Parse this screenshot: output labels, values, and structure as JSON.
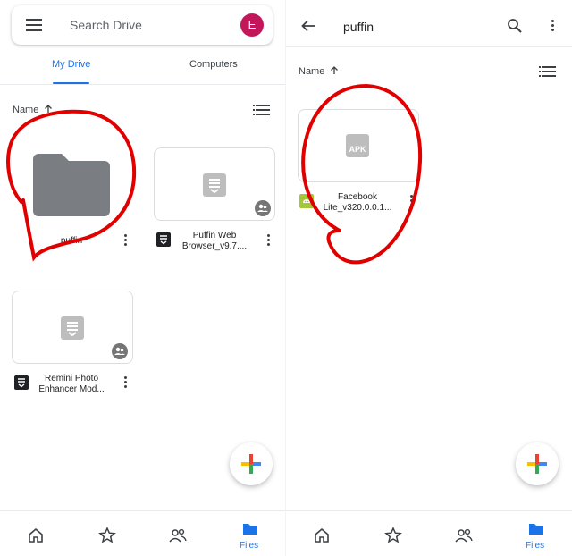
{
  "left": {
    "search": {
      "placeholder": "Search Drive",
      "avatar_letter": "E"
    },
    "tabs": [
      {
        "label": "My Drive",
        "active": true
      },
      {
        "label": "Computers",
        "active": false
      }
    ],
    "sort": {
      "label": "Name",
      "direction": "ascending"
    },
    "items": [
      {
        "type": "folder",
        "name": "puffin"
      },
      {
        "type": "document",
        "name_line1": "Puffin Web",
        "name_line2": "Browser_v9.7....",
        "shared": true
      },
      {
        "type": "document",
        "name_line1": "Remini Photo",
        "name_line2": "Enhancer Mod...",
        "shared": true
      }
    ],
    "nav": {
      "files_label": "Files",
      "items": [
        "home-icon",
        "star-icon",
        "shared-people-icon",
        "files-folder-icon"
      ],
      "active": "files"
    }
  },
  "right": {
    "title": "puffin",
    "sort": {
      "label": "Name",
      "direction": "ascending"
    },
    "items": [
      {
        "type": "apk",
        "thumb_text": "APK",
        "name_line1": "Facebook",
        "name_line2": "Lite_v320.0.0.1..."
      }
    ],
    "nav": {
      "files_label": "Files",
      "items": [
        "home-icon",
        "star-icon",
        "shared-people-icon",
        "files-folder-icon"
      ],
      "active": "files"
    }
  },
  "colors": {
    "accent": "#1a73e8",
    "avatar": "#c2185b",
    "annotation": "#e00000",
    "folder": "#7a7d82",
    "apk_android": "#a4c639",
    "fab_plus": [
      "#4285f4",
      "#ea4335",
      "#fbbc04",
      "#34a853"
    ]
  }
}
